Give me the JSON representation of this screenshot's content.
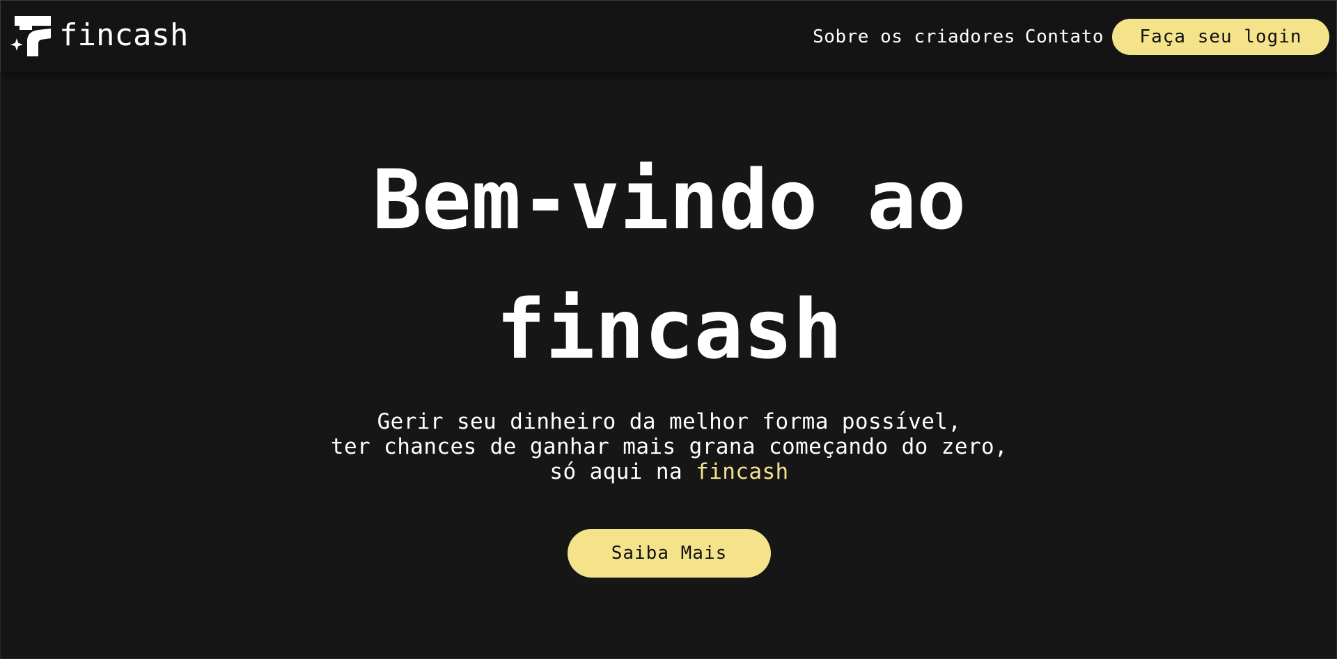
{
  "navbar": {
    "brand": {
      "logo_icon": "fincash-logo-icon",
      "name": "fincash"
    },
    "links": {
      "about": "Sobre os criadores",
      "contact": "Contato"
    },
    "login_button": "Faça seu login"
  },
  "hero": {
    "title_line_1": "Bem-vindo ao",
    "title_line_2": "fincash",
    "subtitle": {
      "line_1": "Gerir seu dinheiro da melhor forma possível,",
      "line_2": "ter chances de ganhar mais grana começando do zero,",
      "line_3_prefix": "só aqui na",
      "line_3_highlight": "fincash"
    },
    "learn_more_button": "Saiba Mais"
  },
  "colors": {
    "background": "#161616",
    "navbar_background": "#141414",
    "accent": "#f5e38c",
    "text": "#ffffff",
    "button_text": "#111111"
  }
}
